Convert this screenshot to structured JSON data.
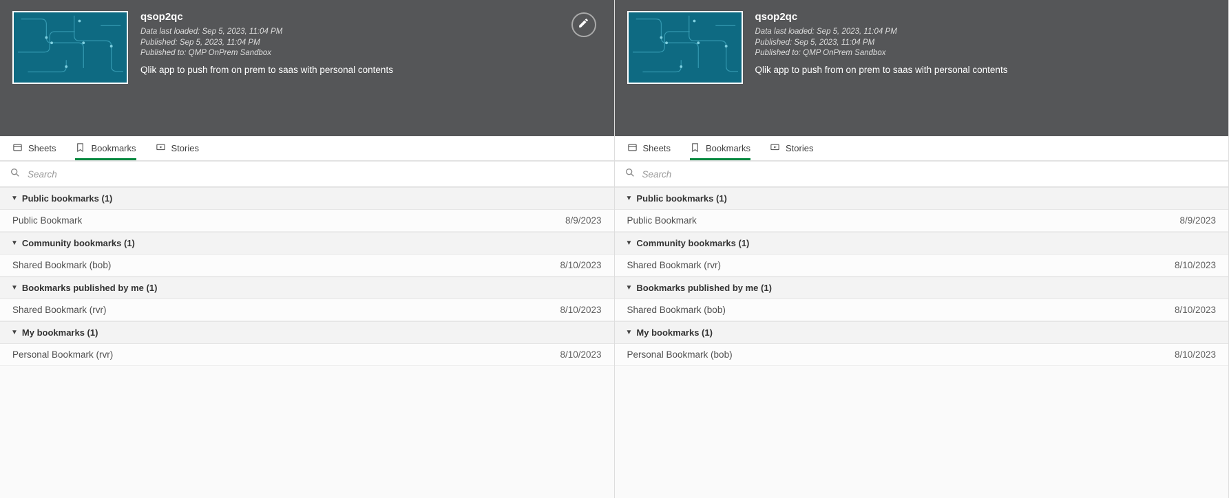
{
  "left": {
    "app_title": "qsop2qc",
    "meta": {
      "loaded": "Data last loaded: Sep 5, 2023, 11:04 PM",
      "published": "Published: Sep 5, 2023, 11:04 PM",
      "published_to": "Published to: QMP OnPrem Sandbox"
    },
    "description": "Qlik app to push from on prem to saas with personal contents",
    "show_edit": true,
    "tabs": {
      "sheets": "Sheets",
      "bookmarks": "Bookmarks",
      "stories": "Stories",
      "active": "bookmarks"
    },
    "search_placeholder": "Search",
    "sections": [
      {
        "title": "Public bookmarks (1)",
        "items": [
          {
            "name": "Public Bookmark",
            "date": "8/9/2023"
          }
        ]
      },
      {
        "title": "Community bookmarks (1)",
        "items": [
          {
            "name": "Shared Bookmark (bob)",
            "date": "8/10/2023"
          }
        ]
      },
      {
        "title": "Bookmarks published by me (1)",
        "items": [
          {
            "name": "Shared Bookmark (rvr)",
            "date": "8/10/2023"
          }
        ]
      },
      {
        "title": "My bookmarks (1)",
        "items": [
          {
            "name": "Personal Bookmark (rvr)",
            "date": "8/10/2023"
          }
        ]
      }
    ]
  },
  "right": {
    "app_title": "qsop2qc",
    "meta": {
      "loaded": "Data last loaded: Sep 5, 2023, 11:04 PM",
      "published": "Published: Sep 5, 2023, 11:04 PM",
      "published_to": "Published to: QMP OnPrem Sandbox"
    },
    "description": "Qlik app to push from on prem to saas with personal contents",
    "show_edit": false,
    "tabs": {
      "sheets": "Sheets",
      "bookmarks": "Bookmarks",
      "stories": "Stories",
      "active": "bookmarks"
    },
    "search_placeholder": "Search",
    "sections": [
      {
        "title": "Public bookmarks (1)",
        "items": [
          {
            "name": "Public Bookmark",
            "date": "8/9/2023"
          }
        ]
      },
      {
        "title": "Community bookmarks (1)",
        "items": [
          {
            "name": "Shared Bookmark (rvr)",
            "date": "8/10/2023"
          }
        ]
      },
      {
        "title": "Bookmarks published by me (1)",
        "items": [
          {
            "name": "Shared Bookmark (bob)",
            "date": "8/10/2023"
          }
        ]
      },
      {
        "title": "My bookmarks (1)",
        "items": [
          {
            "name": "Personal Bookmark (bob)",
            "date": "8/10/2023"
          }
        ]
      }
    ]
  }
}
